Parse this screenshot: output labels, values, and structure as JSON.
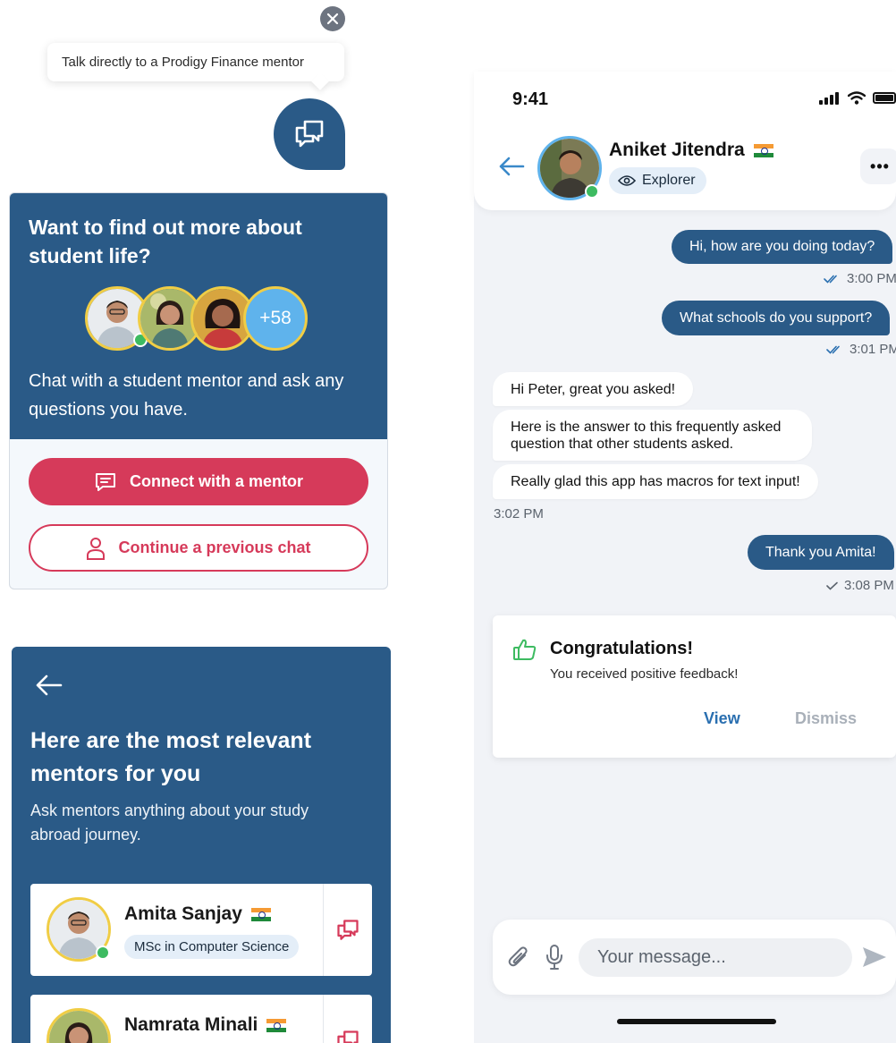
{
  "launcher": {
    "tooltip_text": "Talk directly to a Prodigy Finance mentor"
  },
  "student_life": {
    "title": "Want to find out more about student life?",
    "more_count": "+58",
    "description": "Chat with a student mentor and ask any questions you have.",
    "connect_button": "Connect with a mentor",
    "continue_button": "Continue a previous chat"
  },
  "mentors": {
    "title": "Here are the most relevant mentors for you",
    "subtitle": "Ask mentors anything about your study abroad journey.",
    "items": [
      {
        "name": "Amita Sanjay",
        "tag": "MSc in Computer Science"
      },
      {
        "name": "Namrata Minali",
        "tag": ""
      }
    ]
  },
  "chat": {
    "status_time": "9:41",
    "contact_name": "Aniket Jitendra",
    "contact_badge": "Explorer",
    "more_label": "•••",
    "messages": [
      {
        "text": "Hi, how are you doing today?",
        "time": "3:00 PM"
      },
      {
        "text": "What schools do you support?",
        "time": "3:01 PM"
      },
      {
        "text": "Hi Peter, great you asked!"
      },
      {
        "text": "Here is the answer to this frequently asked question that other students asked."
      },
      {
        "text": "Really glad this app has macros for text input!",
        "time": "3:02 PM"
      },
      {
        "text": "Thank you Amita!",
        "time": "3:08 PM"
      }
    ],
    "notification": {
      "title": "Congratulations!",
      "text": "You received positive feedback!",
      "view_label": "View",
      "dismiss_label": "Dismiss"
    },
    "composer": {
      "placeholder": "Your message..."
    }
  },
  "colors": {
    "primary_blue": "#2a5a87",
    "accent_pink": "#d63a5a",
    "online_green": "#3dbb61",
    "avatar_ring": "#f0cd45",
    "sky_blue": "#5fb3ec"
  }
}
